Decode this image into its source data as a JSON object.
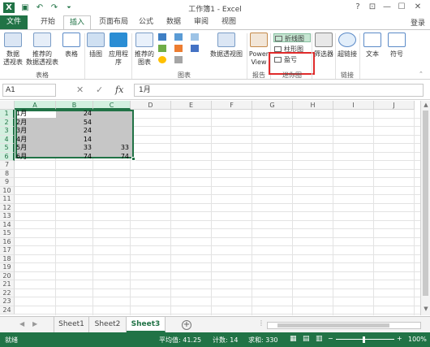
{
  "window": {
    "title": "工作簿1 - Excel",
    "controls": [
      "?",
      "⊡",
      "—",
      "☐",
      "✕"
    ]
  },
  "qat": [
    "✓",
    "↶",
    "↷",
    "⏷"
  ],
  "tabs": [
    {
      "label": "文件"
    },
    {
      "label": "开始"
    },
    {
      "label": "插入"
    },
    {
      "label": "页面布局"
    },
    {
      "label": "公式"
    },
    {
      "label": "数据"
    },
    {
      "label": "审阅"
    },
    {
      "label": "视图"
    }
  ],
  "active_tab": "插入",
  "login": "登录",
  "ribbon": {
    "pivot_table": "数据\n透视表",
    "recommended_pivot": "推荐的\n数据透视表",
    "table": "表格",
    "illustrations": "插图",
    "apps": "应用程\n序",
    "recommended_charts": "推荐的\n图表",
    "pivot_chart": "数据透视图",
    "power_view": "Power\nView",
    "spark_line": "折线图",
    "spark_column": "柱形图",
    "spark_winloss": "盈亏",
    "slicer": "筛选器",
    "hyperlink": "超链接",
    "text": "文本",
    "symbol": "符号",
    "groups": {
      "tables": "表格",
      "charts": "图表",
      "reports": "报告",
      "sparklines": "迷你图",
      "links": "链接"
    }
  },
  "formula_bar": {
    "name_box": "A1",
    "content": "1月",
    "fx": "fx"
  },
  "columns": [
    "A",
    "B",
    "C",
    "D",
    "E",
    "F",
    "G",
    "H",
    "I",
    "J"
  ],
  "rows": [
    "1",
    "2",
    "3",
    "4",
    "5",
    "6",
    "7",
    "8",
    "9",
    "10",
    "11",
    "12",
    "13",
    "14",
    "15",
    "16",
    "17",
    "18",
    "19",
    "20",
    "21",
    "22",
    "23",
    "24"
  ],
  "cells": {
    "A": [
      "1月",
      "2月",
      "3月",
      "4月",
      "5月",
      "6月"
    ],
    "B": [
      "24",
      "54",
      "24",
      "14",
      "33",
      "74"
    ],
    "C": [
      "",
      "",
      "",
      "",
      "33",
      "74"
    ]
  },
  "sheets": [
    {
      "label": "Sheet1"
    },
    {
      "label": "Sheet2"
    },
    {
      "label": "Sheet3"
    }
  ],
  "active_sheet": "Sheet3",
  "status": {
    "ready": "就绪",
    "average": "平均值: 41.25",
    "count": "计数: 14",
    "sum": "求和: 330",
    "zoom": "100%"
  },
  "colors": {
    "accent": "#217346",
    "highlight_box": "#e02b2b",
    "selection": "#c6c6c6"
  }
}
